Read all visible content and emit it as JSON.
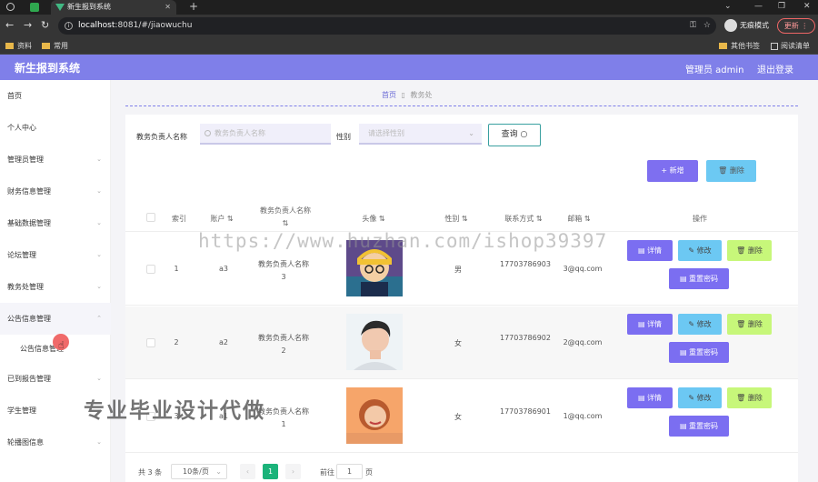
{
  "browser": {
    "tab_title": "新生报到系统",
    "url_host": "localhost",
    "url_rest": ":8081/#/jiaowuchu",
    "incognito_label": "无痕模式",
    "update_label": "更新",
    "bookmarks": [
      "资料",
      "常用"
    ],
    "bookmarks_right": [
      "其他书签",
      "阅读清单"
    ]
  },
  "header": {
    "app_title": "新生报到系统",
    "admin_label": "管理员 admin",
    "logout_label": "退出登录"
  },
  "sidebar": {
    "items": [
      {
        "label": "首页"
      },
      {
        "label": "个人中心"
      },
      {
        "label": "管理员管理"
      },
      {
        "label": "财务信息管理"
      },
      {
        "label": "基础数据管理"
      },
      {
        "label": "论坛管理"
      },
      {
        "label": "教务处管理"
      },
      {
        "label": "公告信息管理"
      },
      {
        "label": "公告信息管理"
      },
      {
        "label": "已到报告管理"
      },
      {
        "label": "学生管理"
      },
      {
        "label": "轮播图信息"
      }
    ]
  },
  "breadcrumb": {
    "home": "首页",
    "current": "教务处"
  },
  "filters": {
    "name_label": "教务负责人名称",
    "name_placeholder": "教务负责人名称",
    "gender_label": "性别",
    "gender_placeholder": "请选择性别",
    "query_label": "查询"
  },
  "actions": {
    "add_label": "新增",
    "delete_label": "删除"
  },
  "table": {
    "headers": {
      "index": "索引",
      "account": "账户",
      "name": "教务负责人名称",
      "avatar": "头像",
      "gender": "性别",
      "phone": "联系方式",
      "email": "邮箱",
      "ops": "操作"
    },
    "rows": [
      {
        "index": "1",
        "account": "a3",
        "name": "教务负责人名称3",
        "gender": "男",
        "phone": "17703786903",
        "email": "3@qq.com"
      },
      {
        "index": "2",
        "account": "a2",
        "name": "教务负责人名称2",
        "gender": "女",
        "phone": "17703786902",
        "email": "2@qq.com"
      },
      {
        "index": "3",
        "account": "a1",
        "name": "教务负责人名称1",
        "gender": "女",
        "phone": "17703786901",
        "email": "1@qq.com"
      }
    ],
    "op_labels": {
      "detail": "详情",
      "edit": "修改",
      "remove": "删除",
      "reset": "重置密码"
    }
  },
  "pagination": {
    "total": "共 3 条",
    "page_size": "10条/页",
    "current_page": "1",
    "goto_prefix": "前往",
    "goto_value": "1",
    "goto_suffix": "页"
  },
  "watermarks": {
    "url_text": "https://www.huzhan.com/ishop39397",
    "promo_text": "专业毕业设计代做"
  },
  "colors": {
    "header": "#7f7fe9",
    "primary_button": "#7b6ef1",
    "info_button": "#6cc8f3",
    "warning_button": "#c7f77a",
    "active_page": "#1bb37a"
  }
}
